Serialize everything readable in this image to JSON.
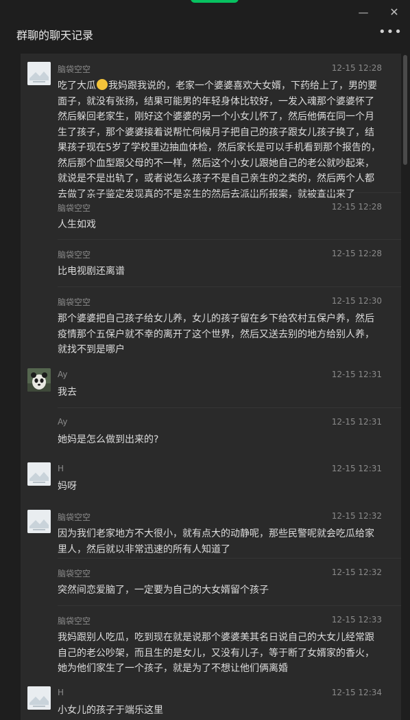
{
  "window": {
    "title": "群聊的聊天记录",
    "minimize_icon": "minimize-icon",
    "close_icon": "close-icon",
    "more_icon": "more-dots-icon",
    "accent_color": "#07c160"
  },
  "messages": [
    {
      "sender": "脑袋空空",
      "time": "12-15 12:28",
      "avatar": "generic",
      "show_avatar": true,
      "text_before": "吃了大瓜",
      "emoji": "shushing-face-emoji",
      "text": "我妈跟我说的，老家一个婆婆喜欢大女婿，下药给上了，男的要面子，就没有张扬，结果可能男的年轻身体比较好，一发入魂那个婆婆怀了然后躲回老家生，刚好这个婆婆的另一个小女儿怀了，然后他俩在同一个月生了孩子，那个婆婆接着说帮忙伺候月子把自己的孩子跟女儿孩子换了，结果孩子现在5岁了学校里边抽血体检，然后家长是可以手机看到那个报告的，然后那个血型跟父母的不一样，然后这个小女儿跟她自己的老公就吵起来，就说是不是出轨了，或者说怎么孩子不是自己亲生的之类的，然后两个人都去做了亲子鉴定发现真的不是亲生的然后去派出所报案，就被查出来了"
    },
    {
      "sender": "脑袋空空",
      "time": "12-15 12:28",
      "avatar": "generic",
      "show_avatar": false,
      "text": "人生如戏"
    },
    {
      "sender": "脑袋空空",
      "time": "12-15 12:28",
      "avatar": "generic",
      "show_avatar": false,
      "text": "比电视剧还离谱"
    },
    {
      "sender": "脑袋空空",
      "time": "12-15 12:30",
      "avatar": "generic",
      "show_avatar": false,
      "text": "那个婆婆把自己孩子给女儿养，女儿的孩子留在乡下给农村五保户养，然后疫情那个五保户就不幸的离开了这个世界，然后又送去别的地方给别人养，就找不到是哪户"
    },
    {
      "sender": "Ay",
      "time": "12-15 12:31",
      "avatar": "panda",
      "show_avatar": true,
      "text": "我去"
    },
    {
      "sender": "Ay",
      "time": "12-15 12:31",
      "avatar": "panda",
      "show_avatar": false,
      "text": "她妈是怎么做到出来的?"
    },
    {
      "sender": "H",
      "time": "12-15 12:31",
      "avatar": "generic",
      "show_avatar": true,
      "text": "妈呀"
    },
    {
      "sender": "脑袋空空",
      "time": "12-15 12:32",
      "avatar": "generic",
      "show_avatar": true,
      "text": "因为我们老家地方不大很小，就有点大的动静呢，那些民警呢就会吃瓜给家里人，然后就以非常迅速的所有人知道了"
    },
    {
      "sender": "脑袋空空",
      "time": "12-15 12:32",
      "avatar": "generic",
      "show_avatar": false,
      "text": "突然间恋爱脑了，一定要为自己的大女婿留个孩子"
    },
    {
      "sender": "脑袋空空",
      "time": "12-15 12:33",
      "avatar": "generic",
      "show_avatar": false,
      "text": "我妈跟别人吃瓜，吃到现在就是说那个婆婆美其名日说自己的大女儿经常跟自己的老公吵架，而且生的是女儿，又没有儿子，等于断了女婿家的香火，她为他们家生了一个孩子，就是为了不想让他们俩离婚"
    },
    {
      "sender": "H",
      "time": "12-15 12:34",
      "avatar": "generic",
      "show_avatar": true,
      "text": "小女儿的孩子于端乐这里"
    }
  ]
}
